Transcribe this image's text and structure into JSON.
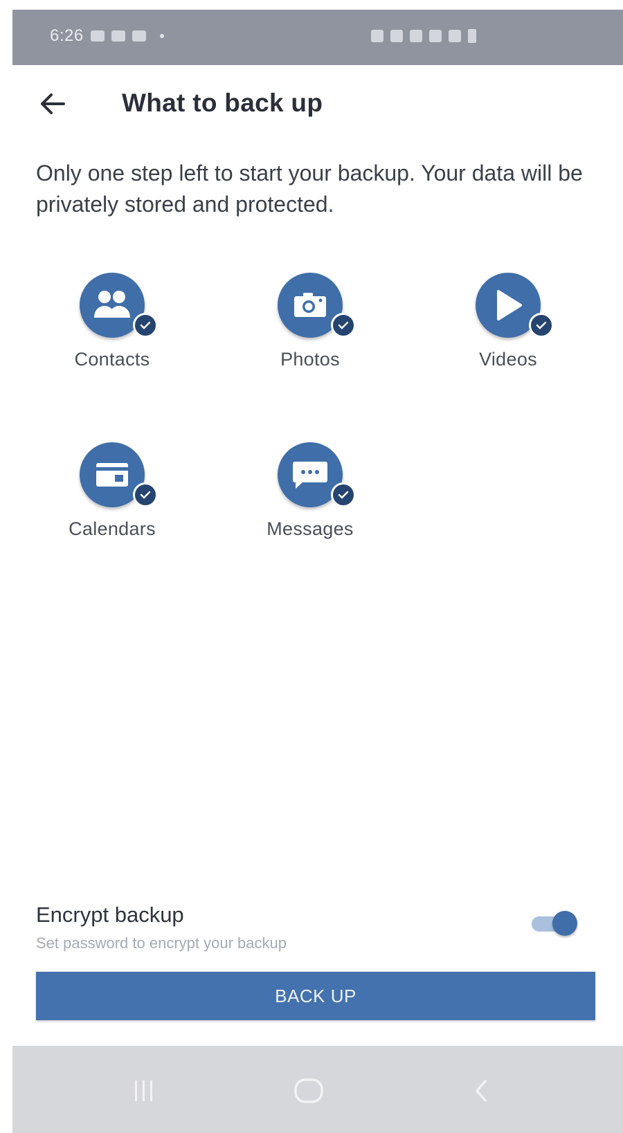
{
  "status_bar": {
    "time": "6:26"
  },
  "header": {
    "back_icon": "arrow-left-icon",
    "title": "What to back up"
  },
  "intro_text": "Only one step left to start your backup. Your data will be privately stored and protected.",
  "items": [
    {
      "label": "Contacts",
      "icon": "contacts-icon",
      "selected": true
    },
    {
      "label": "Photos",
      "icon": "camera-icon",
      "selected": true
    },
    {
      "label": "Videos",
      "icon": "play-icon",
      "selected": true
    },
    {
      "label": "Calendars",
      "icon": "calendar-icon",
      "selected": true
    },
    {
      "label": "Messages",
      "icon": "message-icon",
      "selected": true
    }
  ],
  "encrypt": {
    "title": "Encrypt backup",
    "subtitle": "Set password to encrypt your backup",
    "enabled": true
  },
  "backup_button": {
    "label": "BACK UP"
  },
  "nav_bar": {
    "icons": [
      "recent-apps-icon",
      "home-icon",
      "back-nav-icon"
    ]
  },
  "colors": {
    "accent": "#3f6ea9",
    "check_badge": "#25446f",
    "status_bar": "#8f949f",
    "nav_bar": "#d6d7da"
  }
}
